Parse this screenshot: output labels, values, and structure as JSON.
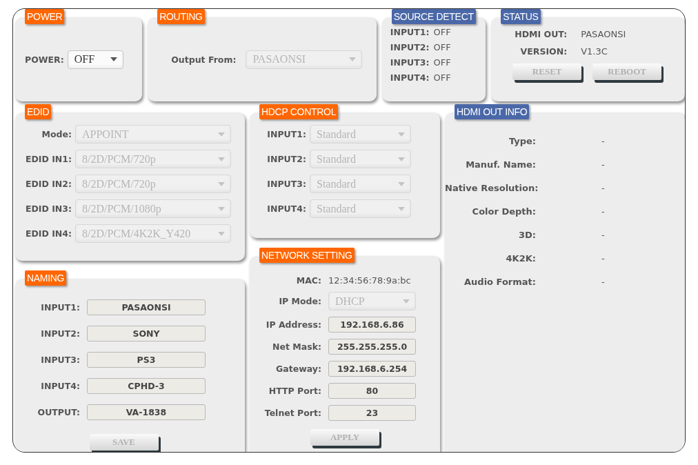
{
  "power": {
    "title": "POWER",
    "color": "#ff6600",
    "label": "POWER:",
    "select": {
      "value": "OFF",
      "disabled": false
    }
  },
  "routing": {
    "title": "ROUTING",
    "color": "#ff6600",
    "label": "Output From:",
    "select": {
      "value": "PASAONSI",
      "disabled": true
    }
  },
  "source_detect": {
    "title": "SOURCE DETECT",
    "color": "#4a68a8",
    "rows": [
      {
        "label": "INPUT1:",
        "value": "OFF"
      },
      {
        "label": "INPUT2:",
        "value": "OFF"
      },
      {
        "label": "INPUT3:",
        "value": "OFF"
      },
      {
        "label": "INPUT4:",
        "value": "OFF"
      }
    ]
  },
  "status": {
    "title": "STATUS",
    "color": "#4a68a8",
    "rows": [
      {
        "label": "HDMI OUT:",
        "value": "PASAONSI"
      },
      {
        "label": "VERSION:",
        "value": "V1.3C"
      }
    ],
    "buttons": [
      {
        "label": "RESET",
        "disabled": true
      },
      {
        "label": "REBOOT",
        "disabled": true
      }
    ]
  },
  "edid": {
    "title": "EDID",
    "color": "#ff6600",
    "rows": [
      {
        "label": "Mode:",
        "value": "APPOINT",
        "disabled": true
      },
      {
        "label": "EDID IN1:",
        "value": "8/2D/PCM/720p",
        "disabled": true
      },
      {
        "label": "EDID IN2:",
        "value": "8/2D/PCM/720p",
        "disabled": true
      },
      {
        "label": "EDID IN3:",
        "value": "8/2D/PCM/1080p",
        "disabled": true
      },
      {
        "label": "EDID IN4:",
        "value": "8/2D/PCM/4K2K_Y420",
        "disabled": true
      }
    ]
  },
  "hdcp_control": {
    "title": "HDCP CONTROL",
    "color": "#ff6600",
    "rows": [
      {
        "label": "INPUT1:",
        "value": "Standard",
        "disabled": true
      },
      {
        "label": "INPUT2:",
        "value": "Standard",
        "disabled": true
      },
      {
        "label": "INPUT3:",
        "value": "Standard",
        "disabled": true
      },
      {
        "label": "INPUT4:",
        "value": "Standard",
        "disabled": true
      }
    ]
  },
  "hdmi_out_info": {
    "title": "HDMI OUT INFO",
    "color": "#4a68a8",
    "rows": [
      {
        "label": "Type:",
        "value": "-"
      },
      {
        "label": "Manuf. Name:",
        "value": "-"
      },
      {
        "label": "Native Resolution:",
        "value": "-"
      },
      {
        "label": "Color Depth:",
        "value": "-"
      },
      {
        "label": "3D:",
        "value": "-"
      },
      {
        "label": "4K2K:",
        "value": "-"
      },
      {
        "label": "Audio Format:",
        "value": "-"
      }
    ]
  },
  "naming": {
    "title": "NAMING",
    "color": "#ff6600",
    "rows": [
      {
        "label": "INPUT1:",
        "value": "PASAONSI"
      },
      {
        "label": "INPUT2:",
        "value": "SONY"
      },
      {
        "label": "INPUT3:",
        "value": "PS3"
      },
      {
        "label": "INPUT4:",
        "value": "CPHD-3"
      },
      {
        "label": "OUTPUT:",
        "value": "VA-1838"
      }
    ],
    "buttons": [
      {
        "label": "SAVE",
        "disabled": true
      }
    ]
  },
  "network_setting": {
    "title": "NETWORK SETTING",
    "color": "#ff6600",
    "rows": [
      {
        "kind": "text",
        "label": "MAC:",
        "value": "12:34:56:78:9a:bc"
      },
      {
        "kind": "select",
        "label": "IP Mode:",
        "value": "DHCP",
        "disabled": true
      },
      {
        "kind": "field",
        "label": "IP Address:",
        "value": "192.168.6.86"
      },
      {
        "kind": "field",
        "label": "Net Mask:",
        "value": "255.255.255.0"
      },
      {
        "kind": "field",
        "label": "Gateway:",
        "value": "192.168.6.254"
      },
      {
        "kind": "field",
        "label": "HTTP Port:",
        "value": "80"
      },
      {
        "kind": "field",
        "label": "Telnet Port:",
        "value": "23"
      }
    ],
    "buttons": [
      {
        "label": "APPLY",
        "disabled": true
      }
    ]
  }
}
